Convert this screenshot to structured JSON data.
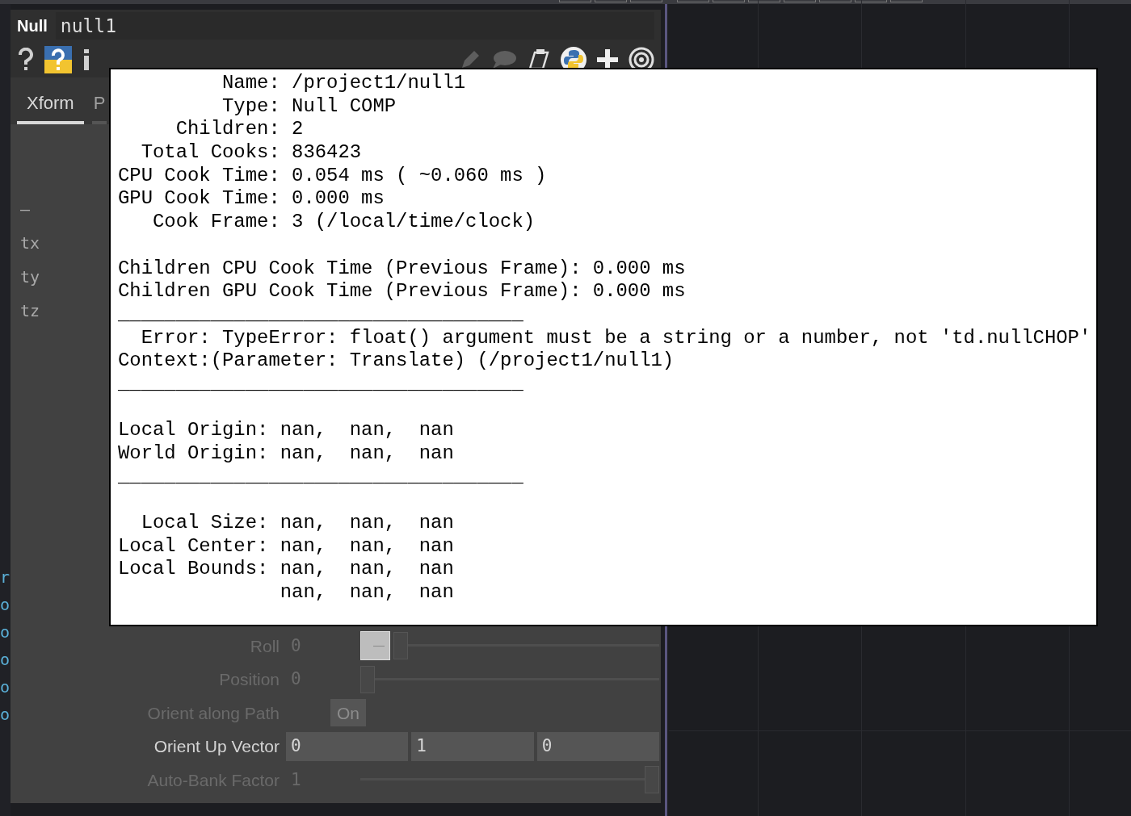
{
  "operator": {
    "type": "Null",
    "name": "null1"
  },
  "page_tabs": [
    {
      "label": "Xform",
      "selected": true
    },
    {
      "label": "P",
      "selected": false
    }
  ],
  "param_labels": [
    "—",
    "tx",
    "ty",
    "tz"
  ],
  "edge_values": [
    "r",
    "o",
    "o",
    "o",
    "o",
    "o"
  ],
  "info_popup": {
    "blocks": [
      [
        "         Name: /project1/null1",
        "         Type: Null COMP",
        "     Children: 2",
        "  Total Cooks: 836423",
        "CPU Cook Time: 0.054 ms ( ~0.060 ms )",
        "GPU Cook Time: 0.000 ms",
        "   Cook Frame: 3 (/local/time/clock)"
      ],
      [
        "Children CPU Cook Time (Previous Frame): 0.000 ms",
        "Children GPU Cook Time (Previous Frame): 0.000 ms",
        "___________________________________",
        "  Error: TypeError: float() argument must be a string or a number, not 'td.nullCHOP'",
        "Context:(Parameter: Translate) (/project1/null1)",
        "___________________________________"
      ],
      [
        "Local Origin: nan,  nan,  nan",
        "World Origin: nan,  nan,  nan",
        "___________________________________"
      ],
      [
        "  Local Size: nan,  nan,  nan",
        "Local Center: nan,  nan,  nan",
        "Local Bounds: nan,  nan,  nan",
        "              nan,  nan,  nan"
      ]
    ]
  },
  "params": [
    {
      "kind": "buttonslider",
      "label": "Roll",
      "value": "0",
      "level": 0,
      "disabled": true
    },
    {
      "kind": "slider",
      "label": "Position",
      "value": "0",
      "level": 0,
      "disabled": true
    },
    {
      "kind": "toggle",
      "label": "Orient along Path",
      "value": "On",
      "disabled": true
    },
    {
      "kind": "vector",
      "label": "Orient Up Vector",
      "values": [
        "0",
        "1",
        "0"
      ],
      "disabled": false
    },
    {
      "kind": "slider",
      "label": "Auto-Bank Factor",
      "value": "1",
      "level": 1,
      "disabled": true
    }
  ]
}
